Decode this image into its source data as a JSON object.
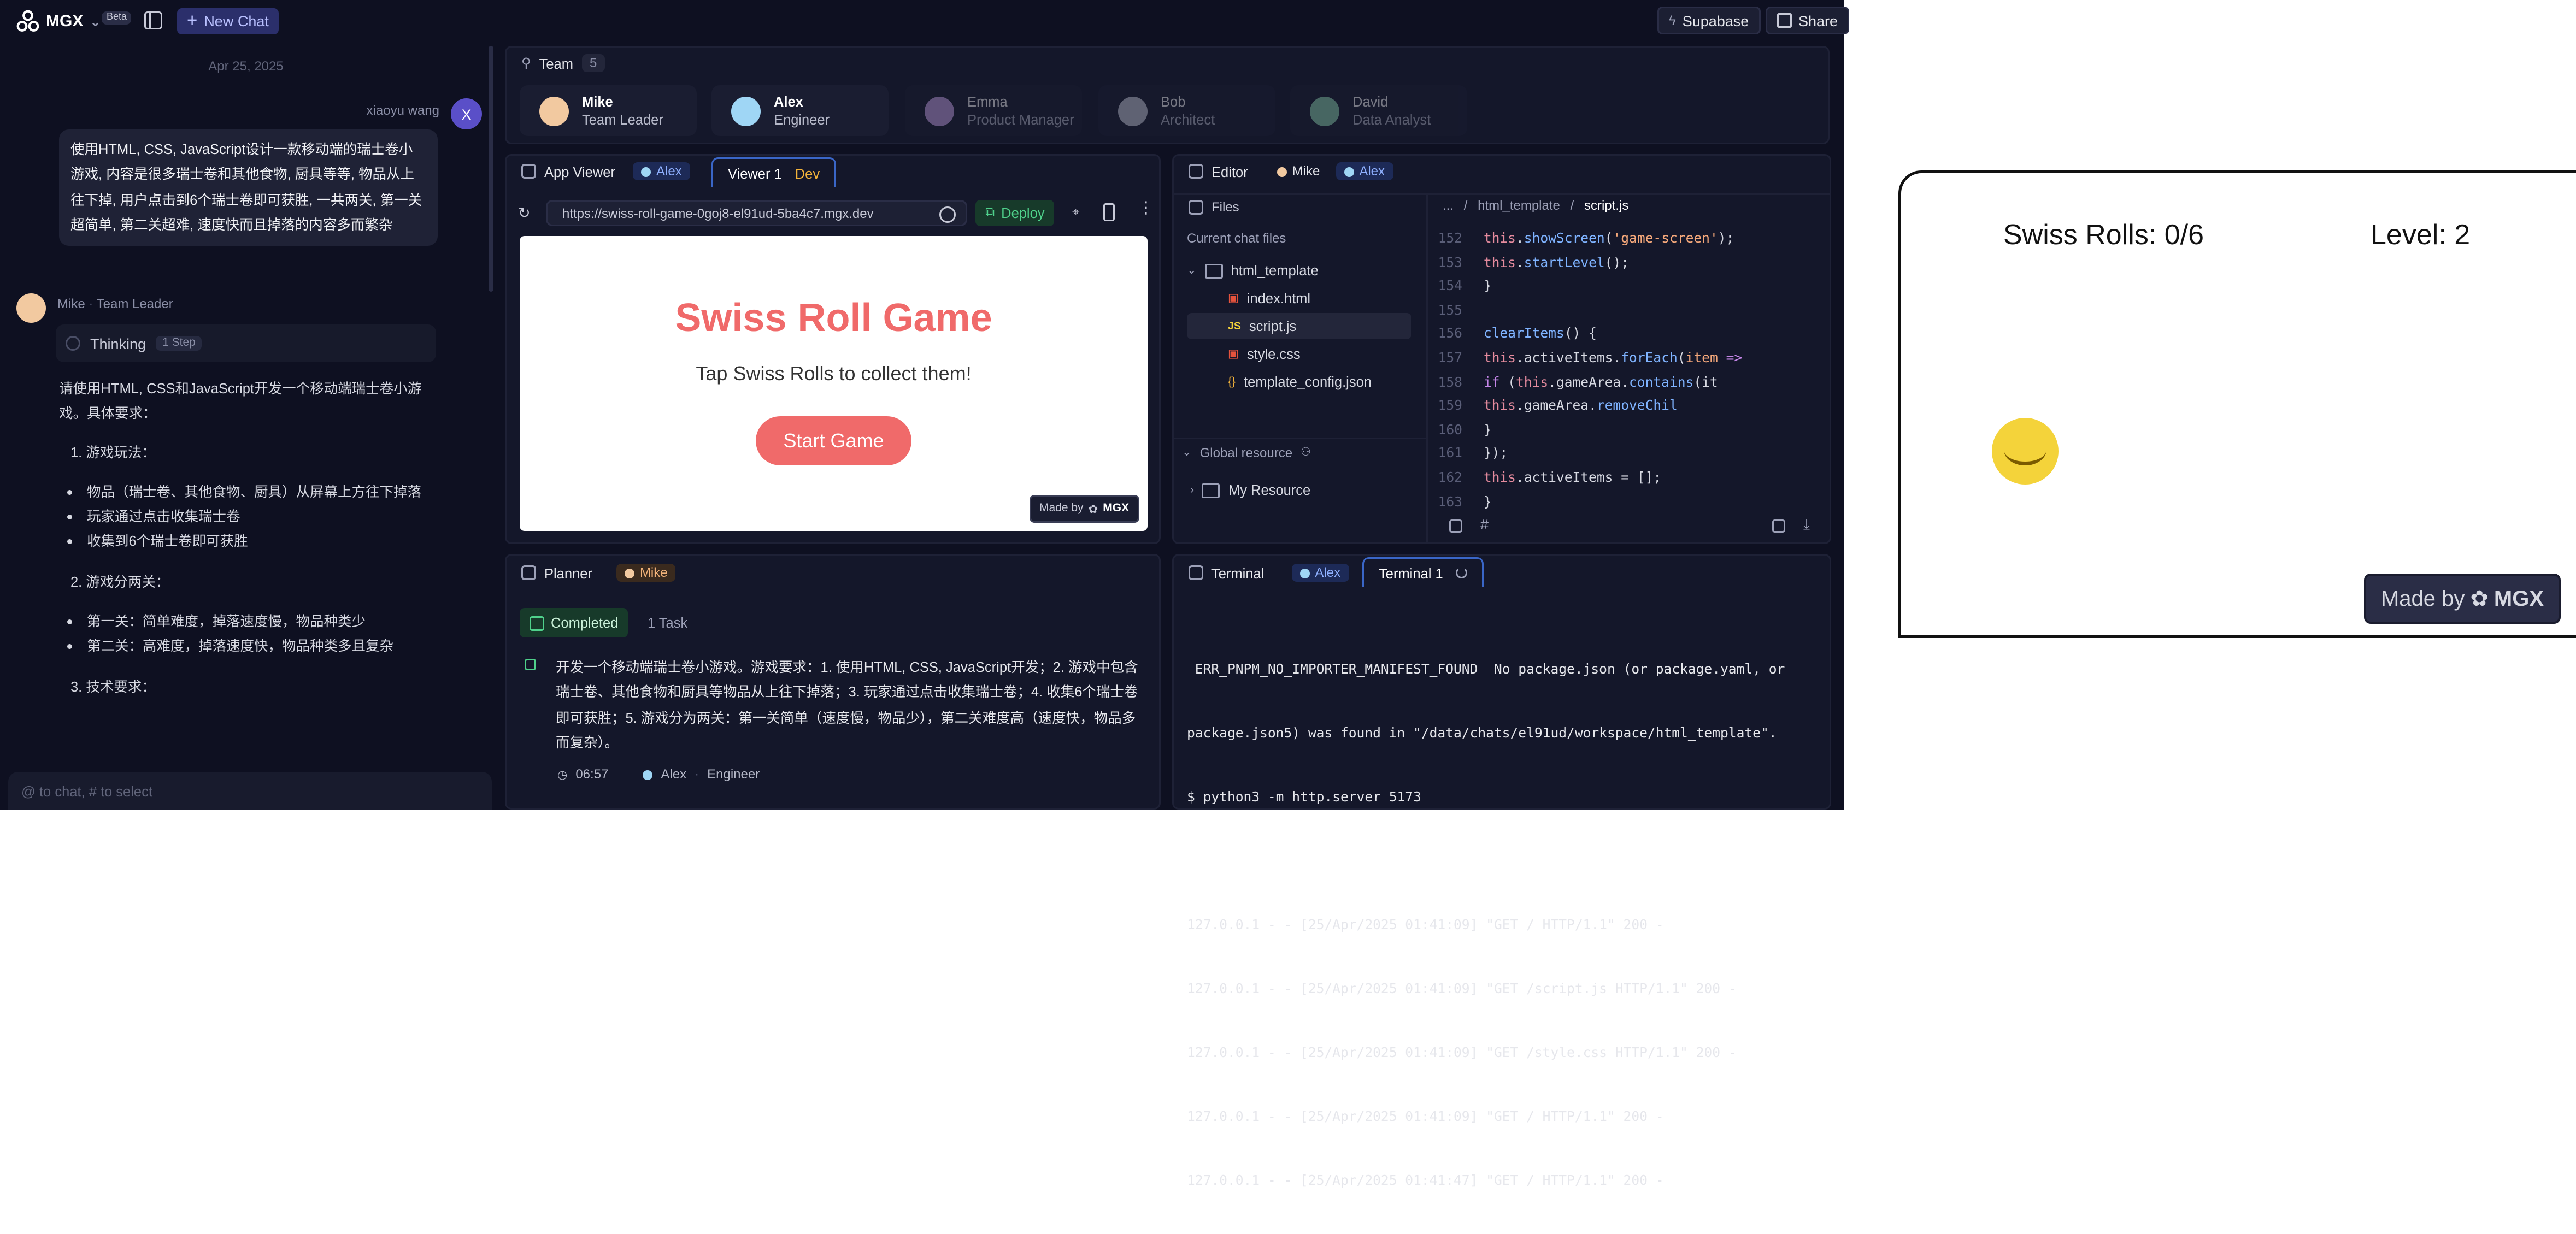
{
  "topbar": {
    "brand": "MGX",
    "beta": "Beta",
    "new_chat": "New Chat",
    "supabase": "Supabase",
    "share": "Share"
  },
  "chat": {
    "date": "Apr 25, 2025",
    "user_name": "xiaoyu wang",
    "user_initial": "X",
    "user_message": "使用HTML, CSS, JavaScript设计一款移动端的瑞士卷小游戏, 内容是很多瑞士卷和其他食物, 厨具等等, 物品从上往下掉, 用户点击到6个瑞士卷即可获胜, 一共两关, 第一关超简单, 第二关超难, 速度快而且掉落的内容多而繁杂",
    "agent_name": "Mike",
    "agent_role": "Team Leader",
    "thinking": "Thinking",
    "thinking_steps": "1 Step",
    "reply_intro": "请使用HTML, CSS和JavaScript开发一个移动端瑞士卷小游戏。具体要求：",
    "section1_title": "1. 游戏玩法：",
    "section1_items": [
      "物品（瑞士卷、其他食物、厨具）从屏幕上方往下掉落",
      "玩家通过点击收集瑞士卷",
      "收集到6个瑞士卷即可获胜"
    ],
    "section2_title": "2. 游戏分两关：",
    "section2_items": [
      "第一关：简单难度，掉落速度慢，物品种类少",
      "第二关：高难度，掉落速度快，物品种类多且复杂"
    ],
    "section3_title": "3. 技术要求：",
    "input_placeholder": "@ to chat, # to select"
  },
  "team": {
    "title": "Team",
    "count": "5",
    "members": [
      {
        "name": "Mike",
        "role": "Team Leader",
        "color": "#f2c9a0"
      },
      {
        "name": "Alex",
        "role": "Engineer",
        "color": "#9fd6f5"
      },
      {
        "name": "Emma",
        "role": "Product Manager",
        "color": "#c9a3e8"
      },
      {
        "name": "Bob",
        "role": "Architect",
        "color": "#c8cad8"
      },
      {
        "name": "David",
        "role": "Data Analyst",
        "color": "#8fd3b0"
      }
    ]
  },
  "app_viewer": {
    "title": "App Viewer",
    "agent_chip": "Alex",
    "tab_label": "Viewer 1",
    "tab_badge": "Dev",
    "url": "https://swiss-roll-game-0goj8-el91ud-5ba4c7.mgx.dev",
    "deploy": "Deploy",
    "game_title": "Swiss Roll Game",
    "game_subtitle": "Tap Swiss Rolls to collect them!",
    "start_button": "Start Game",
    "made_by": "Made by",
    "made_by_brand": "MGX"
  },
  "editor": {
    "title": "Editor",
    "chip_mike": "Mike",
    "chip_alex": "Alex",
    "files_label": "Files",
    "breadcrumb": [
      "...",
      "html_template",
      "script.js"
    ],
    "current_chat_files": "Current chat files",
    "folder": "html_template",
    "files": [
      "index.html",
      "script.js",
      "style.css",
      "template_config.json"
    ],
    "global_resource": "Global resource",
    "my_resource": "My Resource",
    "code_lines": [
      {
        "n": "152",
        "t": "            this.showScreen('game-screen');"
      },
      {
        "n": "153",
        "t": "            this.startLevel();"
      },
      {
        "n": "154",
        "t": "        }"
      },
      {
        "n": "155",
        "t": ""
      },
      {
        "n": "156",
        "t": "        clearItems() {"
      },
      {
        "n": "157",
        "t": "            this.activeItems.forEach(item =>"
      },
      {
        "n": "158",
        "t": "                if (this.gameArea.contains(it"
      },
      {
        "n": "159",
        "t": "                    this.gameArea.removeChil"
      },
      {
        "n": "160",
        "t": "                }"
      },
      {
        "n": "161",
        "t": "            });"
      },
      {
        "n": "162",
        "t": "            this.activeItems = [];"
      },
      {
        "n": "163",
        "t": "        }"
      },
      {
        "n": "164",
        "t": ""
      }
    ]
  },
  "planner": {
    "title": "Planner",
    "chip": "Mike",
    "status": "Completed",
    "task_count": "1 Task",
    "task": "开发一个移动端瑞士卷小游戏。游戏要求：1. 使用HTML, CSS, JavaScript开发；2. 游戏中包含瑞士卷、其他食物和厨具等物品从上往下掉落；3. 玩家通过点击收集瑞士卷；4. 收集6个瑞士卷即可获胜；5. 游戏分为两关：第一关简单（速度慢，物品少），第二关难度高（速度快，物品多而复杂）。",
    "time": "06:57",
    "assignee": "Alex",
    "assignee_role": "Engineer"
  },
  "terminal": {
    "title": "Terminal",
    "chip": "Alex",
    "tab": "Terminal 1",
    "lines": [
      " ERR_PNPM_NO_IMPORTER_MANIFEST_FOUND  No package.json (or package.yaml, or",
      "package.json5) was found in \"/data/chats/el91ud/workspace/html_template\".",
      "$ python3 -m http.server 5173",
      "",
      "127.0.0.1 - - [25/Apr/2025 01:41:09] \"GET / HTTP/1.1\" 200 -",
      "127.0.0.1 - - [25/Apr/2025 01:41:09] \"GET /script.js HTTP/1.1\" 200 -",
      "127.0.0.1 - - [25/Apr/2025 01:41:09] \"GET /style.css HTTP/1.1\" 200 -",
      "127.0.0.1 - - [25/Apr/2025 01:41:09] \"GET / HTTP/1.1\" 200 -",
      "127.0.0.1 - - [25/Apr/2025 01:41:47] \"GET / HTTP/1.1\" 200 -"
    ]
  },
  "zoom_preview": {
    "score": "Swiss Rolls: 0/6",
    "level": "Level: 2",
    "made_by": "Made by",
    "brand": "MGX"
  }
}
